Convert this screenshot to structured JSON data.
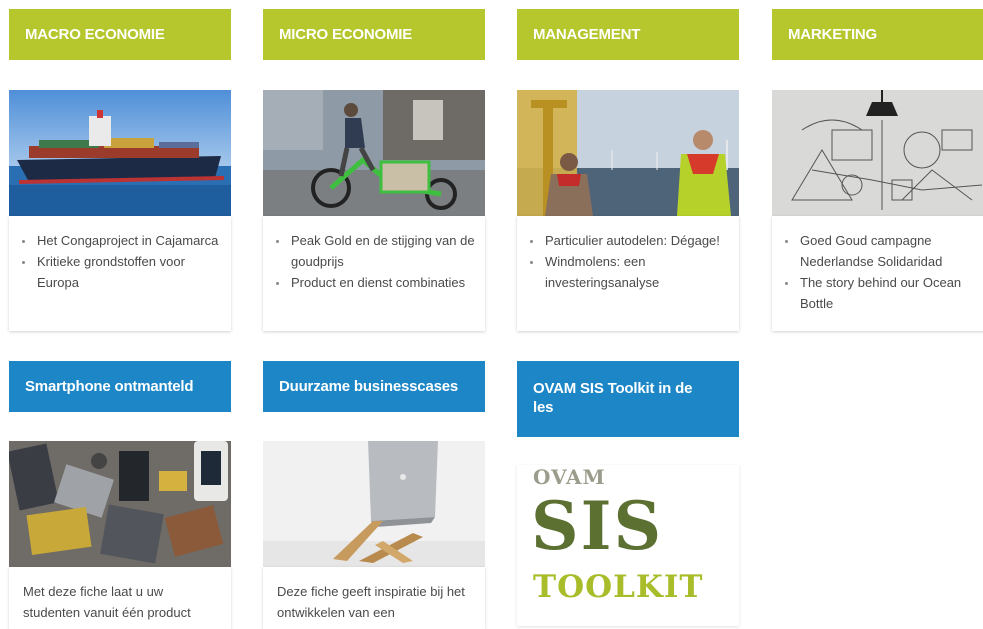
{
  "row1": [
    {
      "title": "MACRO ECONOMIE",
      "image": "container-ship-photo",
      "items": [
        "Het Congaproject in Cajamarca",
        "Kritieke grondstoffen voor Europa"
      ]
    },
    {
      "title": "MICRO ECONOMIE",
      "image": "cargo-bike-photo",
      "items": [
        "Peak Gold en de stijging van de goudprijs",
        "Product en dienst combinaties"
      ]
    },
    {
      "title": "MANAGEMENT",
      "image": "wind-farm-photo",
      "items": [
        "Particulier autodelen: Dégage!",
        "Windmolens: een investeringsanalyse"
      ]
    },
    {
      "title": "MARKETING",
      "image": "sketch-lamp-photo",
      "items": [
        "Goed Goud campagne Nederlandse Solidaridad",
        "The story behind our Ocean Bottle"
      ]
    }
  ],
  "row2": [
    {
      "title": "Smartphone ontmanteld",
      "image": "disassembled-phones-photo",
      "text": "Met deze fiche laat u uw studenten vanuit één product"
    },
    {
      "title": "Duurzame businesscases",
      "image": "laptop-stand-photo",
      "text": "Deze fiche geeft inspiratie bij het ontwikkelen van een"
    },
    {
      "title_line1": "OVAM SIS Toolkit in de",
      "title_line2": "les",
      "logo": {
        "top": "OVAM",
        "middle": "SIS",
        "bottom": "TOOLKIT"
      }
    }
  ],
  "colors": {
    "green_header": "#b5c72d",
    "blue_header": "#1c86c6",
    "logo_dark": "#5c7032",
    "logo_light": "#a9bc2a",
    "logo_grey": "#9c9c8c"
  }
}
